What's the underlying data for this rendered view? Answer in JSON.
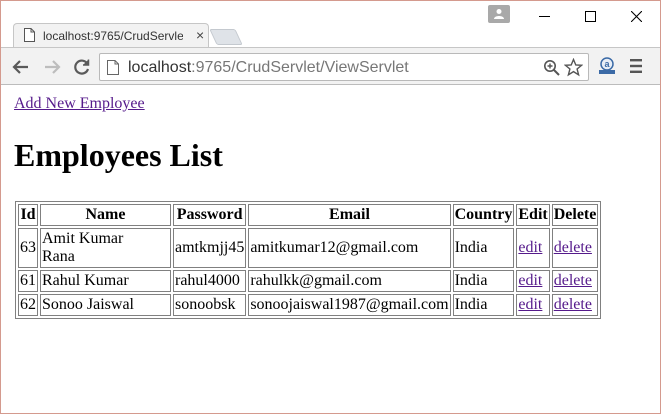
{
  "browser": {
    "tab_title": "localhost:9765/CrudServle",
    "tab_close": "×",
    "url_host": "localhost",
    "url_rest": ":9765/CrudServlet/ViewServlet"
  },
  "page": {
    "add_link": "Add New Employee",
    "title": "Employees List"
  },
  "table": {
    "headers": [
      "Id",
      "Name",
      "Password",
      "Email",
      "Country",
      "Edit",
      "Delete"
    ],
    "rows": [
      {
        "id": "63",
        "name_line1": "Amit Kumar",
        "name_line2": "Rana",
        "password": "amtkmjj45",
        "email": "amitkumar12@gmail.com",
        "country": "India",
        "edit": "edit",
        "delete": "delete"
      },
      {
        "id": "61",
        "name_line1": "Rahul Kumar",
        "name_line2": "",
        "password": "rahul4000",
        "email": "rahulkk@gmail.com",
        "country": "India",
        "edit": "edit",
        "delete": "delete"
      },
      {
        "id": "62",
        "name_line1": "Sonoo Jaiswal",
        "name_line2": "",
        "password": "sonoobsk",
        "email": "sonoojaiswal1987@gmail.com",
        "country": "India",
        "edit": "edit",
        "delete": "delete"
      }
    ]
  },
  "icons": {
    "page": "page-icon",
    "back": "back-arrow-icon",
    "forward": "forward-arrow-icon",
    "reload": "reload-icon",
    "zoom": "zoom-icon",
    "star": "star-icon",
    "extension": "extension-icon",
    "menu": "menu-icon"
  },
  "colors": {
    "visited_link": "#551a8b",
    "toolbar_bg": "#f2f2f2",
    "window_border": "#d49a8e"
  }
}
